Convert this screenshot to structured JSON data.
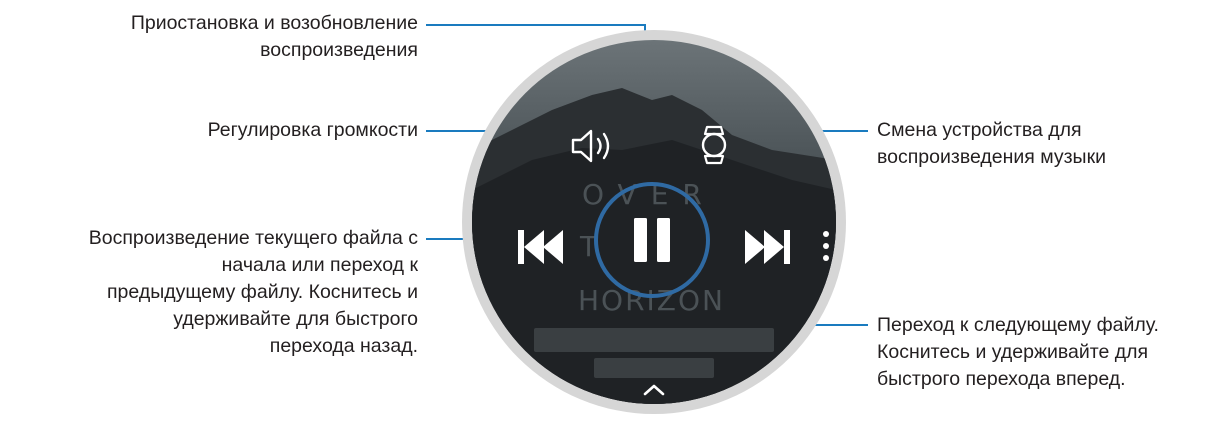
{
  "callouts": {
    "pause_resume": [
      "Приостановка и возобновление",
      "воспроизведения"
    ],
    "volume": [
      "Регулировка громкости"
    ],
    "device_switch": [
      "Смена устройства для",
      "воспроизведения музыки"
    ],
    "previous": [
      "Воспроизведение текущего файла с",
      "начала или переход к",
      "предыдущему файлу. Коснитесь и",
      "удерживайте для быстрого",
      "перехода назад."
    ],
    "next": [
      "Переход к следующему файлу.",
      "Коснитесь и удерживайте для",
      "быстрого перехода вперед."
    ]
  },
  "screen": {
    "track_text_line1": "OVER",
    "track_text_line2": "T",
    "track_text_line3": "HORIZON"
  },
  "icons": {
    "volume": "speaker-icon",
    "device": "watch-icon",
    "previous": "skip-previous-icon",
    "play_pause": "pause-icon",
    "next": "skip-next-icon",
    "more": "more-vertical-icon",
    "expand": "chevron-up-icon"
  },
  "colors": {
    "callout_line": "#1a7bbf",
    "accent_ring": "#2f6aa3",
    "text": "#231f20"
  }
}
